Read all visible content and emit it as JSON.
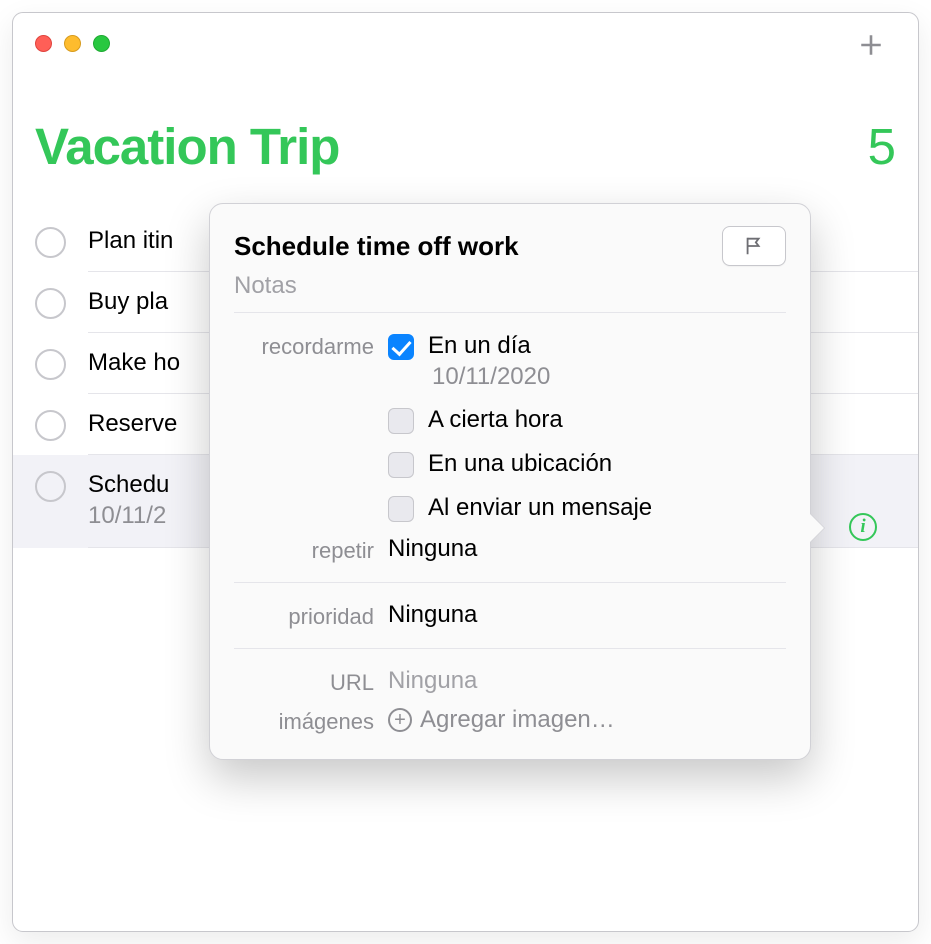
{
  "header": {
    "list_title": "Vacation Trip",
    "list_count": "5"
  },
  "reminders": [
    {
      "title": "Plan itin",
      "subtitle": ""
    },
    {
      "title": "Buy pla",
      "subtitle": ""
    },
    {
      "title": "Make ho",
      "subtitle": ""
    },
    {
      "title": "Reserve",
      "subtitle": ""
    },
    {
      "title": "Schedu",
      "subtitle": "10/11/2"
    }
  ],
  "popover": {
    "title": "Schedule time off work",
    "notes_placeholder": "Notas",
    "remind_label": "recordarme",
    "remind_options": [
      {
        "label": "En un día",
        "checked": true,
        "detail": "10/11/2020"
      },
      {
        "label": "A cierta hora",
        "checked": false
      },
      {
        "label": "En una ubicación",
        "checked": false
      },
      {
        "label": "Al enviar un mensaje",
        "checked": false
      }
    ],
    "repeat_label": "repetir",
    "repeat_value": "Ninguna",
    "priority_label": "prioridad",
    "priority_value": "Ninguna",
    "url_label": "URL",
    "url_value": "Ninguna",
    "images_label": "imágenes",
    "add_image_label": "Agregar imagen…"
  },
  "info_icon_glyph": "i"
}
